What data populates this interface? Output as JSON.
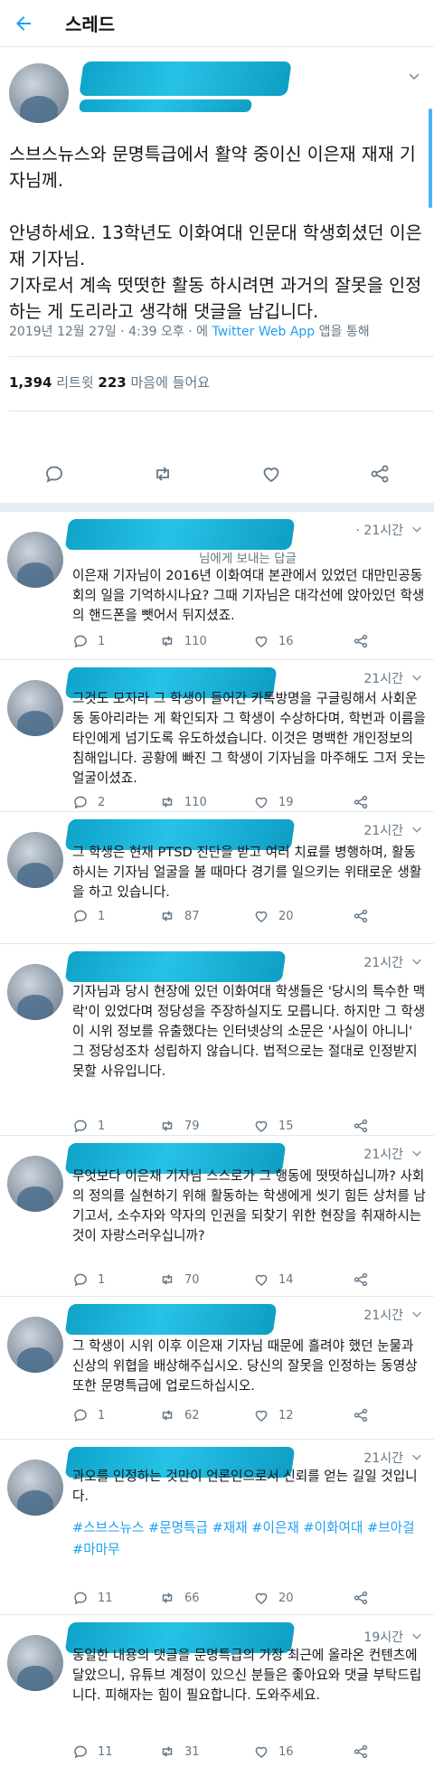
{
  "header": {
    "title": "스레드"
  },
  "tweet": {
    "text": "스브스뉴스와 문명특급에서 활약 중이신 이은재 재재 기자님께.\n\n안녕하세요. 13학년도 이화여대 인문대 학생회셨던 이은재 기자님.\n기자로서 계속 떳떳한 활동 하시려면 과거의 잘못을 인정하는 게 도리라고 생각해 댓글을 남깁니다.",
    "meta_date": "2019년 12월 27일 · 4:39 오후 · 에 ",
    "meta_app": "Twitter Web App",
    "meta_tail": " 앱을 통해",
    "retweet_count": "1,394",
    "retweet_label": " 리트윗  ",
    "like_count": "223",
    "like_label": " 마음에 들어요"
  },
  "replies": [
    {
      "time": "· 21시간",
      "reply_to": "님에게 보내는 답글",
      "text": "이은재 기자님이 2016년 이화여대 본관에서 있었던 대만민공동회의 일을 기억하시나요? 그때 기자님은 대각선에 앉아있던 학생의 핸드폰을 뺏어서 뒤지셨죠.",
      "replies": "1",
      "retweets": "110",
      "likes": "16"
    },
    {
      "time": "21시간",
      "text": "그것도 모자라 그 학생이 들어간 카톡방명을 구글링해서 사회운동 동아리라는 게 확인되자 그 학생이 수상하다며, 학번과 이름을 타인에게 넘기도록 유도하셨습니다. 이것은 명백한 개인정보의 침해입니다. 공황에 빠진 그 학생이 기자님을 마주해도 그저 웃는 얼굴이셨죠.",
      "replies": "2",
      "retweets": "110",
      "likes": "19"
    },
    {
      "time": "21시간",
      "text": "그 학생은 현재 PTSD 진단을 받고 여러 치료를 병행하며, 활동하시는 기자님 얼굴을 볼 때마다 경기를 일으키는 위태로운 생활을 하고 있습니다.",
      "replies": "1",
      "retweets": "87",
      "likes": "20"
    },
    {
      "time": "21시간",
      "text": "기자님과 당시 현장에 있던 이화여대 학생들은 '당시의 특수한 맥락'이 있었다며 정당성을 주장하실지도 모릅니다. 하지만 그 학생이 시위 정보를 유출했다는 인터넷상의 소문은 '사실이 아니니' 그 정당성조차 성립하지 않습니다. 법적으로는 절대로 인정받지 못할 사유입니다.",
      "replies": "1",
      "retweets": "79",
      "likes": "15"
    },
    {
      "time": "21시간",
      "text": "무엇보다 이은재 기자님 스스로가 그 행동에 떳떳하십니까? 사회의 정의를 실현하기 위해 활동하는 학생에게 씻기 힘든 상처를 남기고서, 소수자와 약자의 인권을 되찾기 위한 현장을 취재하시는 것이 자랑스러우십니까?",
      "replies": "1",
      "retweets": "70",
      "likes": "14"
    },
    {
      "time": "21시간",
      "text": "그 학생이 시위 이후 이은재 기자님 때문에 흘려야 했던 눈물과 신상의 위협을 배상해주십시오. 당신의 잘못을 인정하는 동영상 또한 문명특급에 업로드하십시오.",
      "replies": "1",
      "retweets": "62",
      "likes": "12"
    },
    {
      "time": "21시간",
      "text": "과오를 인정하는 것만이 언론인으로서 신뢰를 얻는 길일 것입니다.",
      "hashtags": "#스브스뉴스 #문명특급 #재재 #이은재 #이화여대 #브아걸 #마마무",
      "replies": "11",
      "retweets": "66",
      "likes": "20"
    },
    {
      "time": "19시간",
      "text": "동일한 내용의 댓글을 문명특급의 가장 최근에 올라온 컨텐츠에 달았으니, 유튜브 계정이 있으신 분들은 좋아요와 댓글 부탁드립니다. 피해자는 힘이 필요합니다. 도와주세요.",
      "replies": "11",
      "retweets": "31",
      "likes": "16"
    }
  ],
  "icons": {
    "back": "arrow-left-icon",
    "reply": "speech-bubble-icon",
    "retweet": "retweet-icon",
    "like": "heart-icon",
    "share": "share-icon",
    "more": "chevron-down-icon"
  },
  "colors": {
    "accent": "#1da1f2",
    "muted": "#657786",
    "redaction": "#1ab3db"
  }
}
